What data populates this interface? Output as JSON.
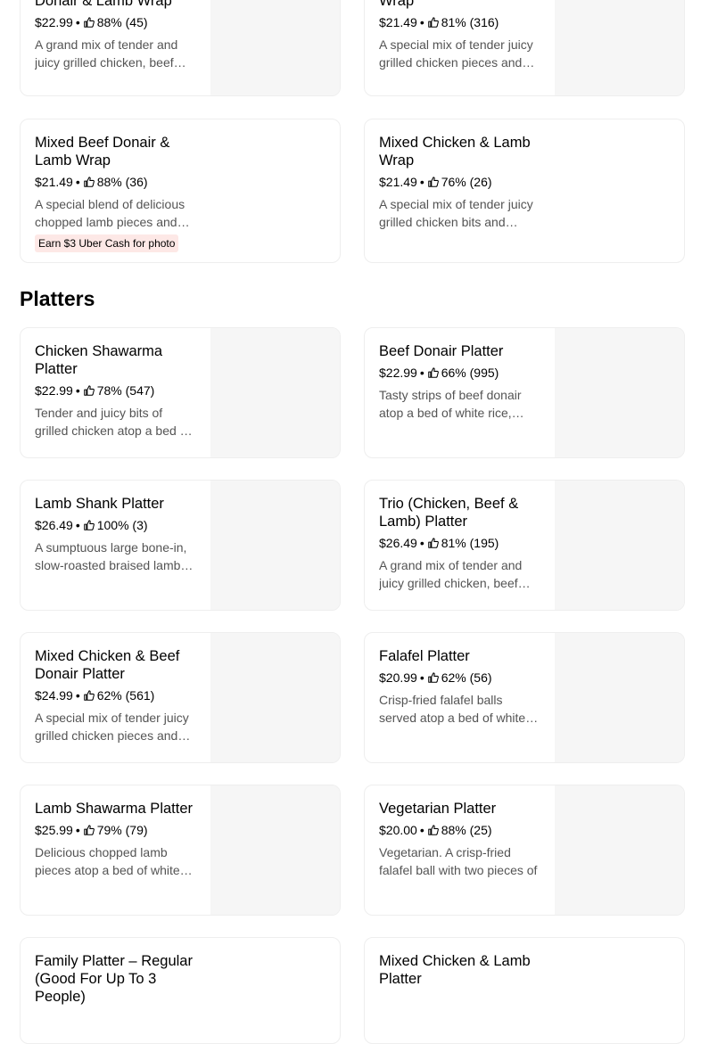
{
  "wraps": [
    {
      "name": "Donair &  Lamb Wrap",
      "price": "$22.99",
      "rating": "88% (45)",
      "description": "A grand mix of tender and juicy grilled chicken, beef donair and lamb"
    },
    {
      "name": "Wrap",
      "price": "$21.49",
      "rating": "81% (316)",
      "description": "A special mix of tender juicy grilled chicken pieces and beef donair"
    },
    {
      "name": "Mixed Beef Donair & Lamb Wrap",
      "price": "$21.49",
      "rating": "88% (36)",
      "description": "A special blend of delicious chopped lamb pieces and beef donair",
      "promo": "Earn $3 Uber Cash for photo"
    },
    {
      "name": "Mixed Chicken &  Lamb Wrap",
      "price": "$21.49",
      "rating": "76% (26)",
      "description": "A special mix of tender juicy grilled chicken bits and chopped lamb"
    }
  ],
  "platters_section": {
    "title": "Platters"
  },
  "platters": [
    {
      "name": "Chicken Shawarma Platter",
      "price": "$22.99",
      "rating": "78% (547)",
      "description": "Tender and juicy bits of grilled chicken atop a bed of white rice"
    },
    {
      "name": "Beef Donair Platter",
      "price": "$22.99",
      "rating": "66% (995)",
      "description": "Tasty strips of beef donair atop a bed of white rice, served"
    },
    {
      "name": "Lamb Shank Platter",
      "price": "$26.49",
      "rating": "100% (3)",
      "description": "A sumptuous large bone-in, slow-roasted braised lamb shank"
    },
    {
      "name": "Trio (Chicken, Beef & Lamb) Platter",
      "price": "$26.49",
      "rating": "81% (195)",
      "description": "A grand mix of tender and juicy grilled chicken, beef donair"
    },
    {
      "name": "Mixed Chicken &  Beef Donair Platter",
      "price": "$24.99",
      "rating": "62% (561)",
      "description": "A special mix of tender juicy grilled chicken pieces and beef donair"
    },
    {
      "name": "Falafel Platter",
      "price": "$20.99",
      "rating": "62% (56)",
      "description": "Crisp-fried falafel balls served atop a bed of white rice"
    },
    {
      "name": "Lamb Shawarma Platter",
      "price": "$25.99",
      "rating": "79% (79)",
      "description": "Delicious chopped lamb pieces atop a bed of white rice"
    },
    {
      "name": "Vegetarian Platter",
      "price": "$20.00",
      "rating": "88% (25)",
      "description": "Vegetarian. A crisp-fried falafel ball with two pieces of"
    },
    {
      "name": "Family Platter – Regular (Good For Up To 3 People)",
      "price": "",
      "rating": "",
      "description": ""
    },
    {
      "name": "Mixed Chicken &  Lamb Platter",
      "price": "",
      "rating": "",
      "description": ""
    }
  ],
  "icons": {
    "rating": "thumbs-up-icon"
  },
  "colors": {
    "promo_bg": "#fde8e6",
    "image_placeholder": "#f6f6f6",
    "card_border": "#eeeeee",
    "description_text": "#545454"
  }
}
